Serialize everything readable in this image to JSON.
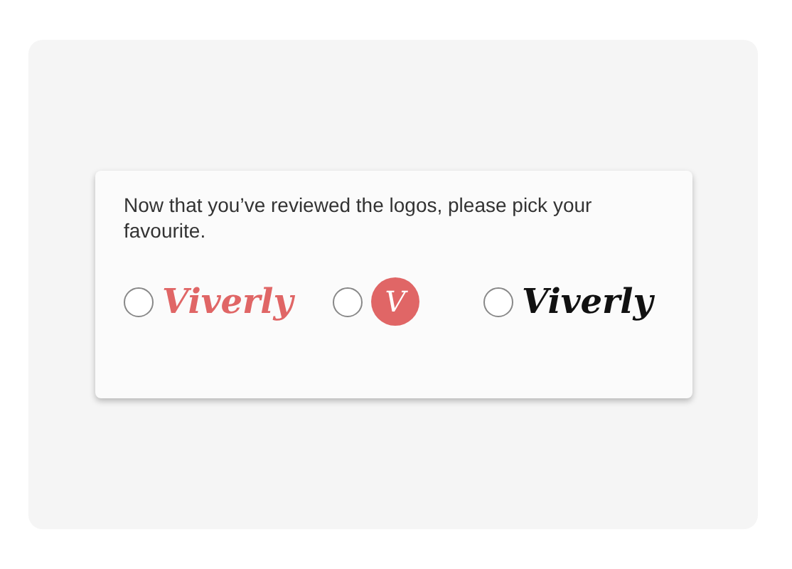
{
  "question": "Now that you’ve reviewed the logos, please pick your favourite.",
  "options": [
    {
      "kind": "wordmark",
      "text": "Viverly",
      "color": "#e06666",
      "selected": false
    },
    {
      "kind": "badge",
      "text": "V",
      "color": "#e06666",
      "selected": false
    },
    {
      "kind": "wordmark",
      "text": "Viverly",
      "color": "#111111",
      "selected": false
    }
  ]
}
